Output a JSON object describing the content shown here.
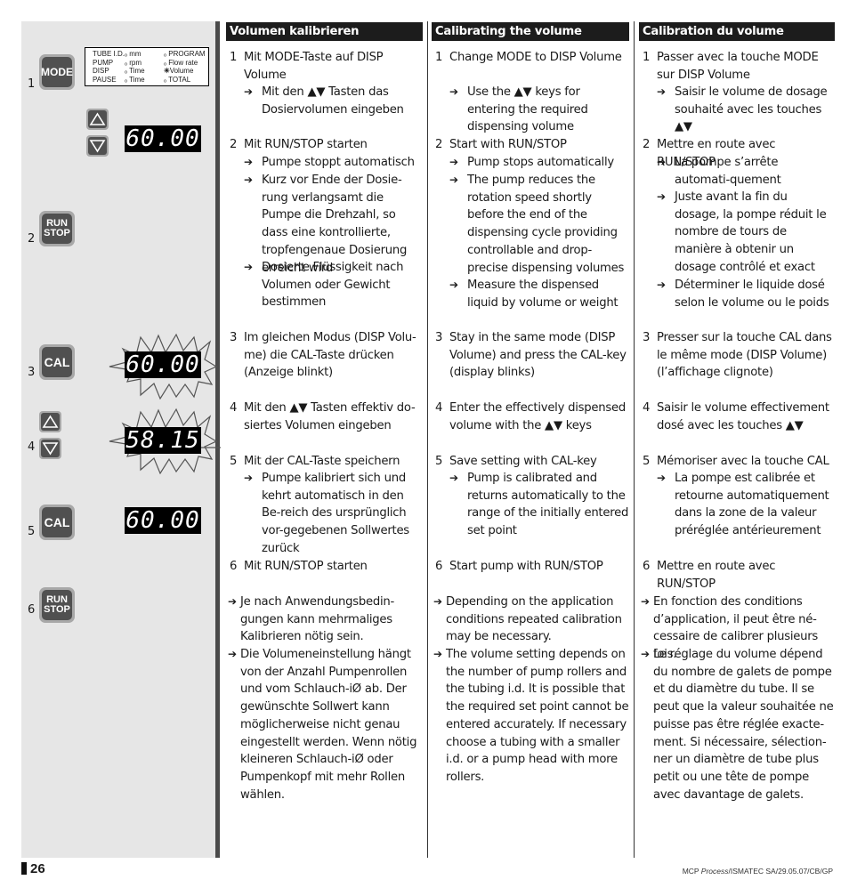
{
  "left_panel": {
    "step_numbers": [
      "1",
      "2",
      "3",
      "4",
      "5",
      "6"
    ],
    "keys": {
      "mode": "MODE",
      "run": "RUN",
      "stop": "STOP",
      "cal": "CAL"
    },
    "mode_display": {
      "col1": [
        "TUBE I.D.",
        "PUMP",
        "DISP",
        "PAUSE"
      ],
      "col2": [
        "mm",
        "rpm",
        "Time",
        "Time"
      ],
      "col3": [
        "PROGRAM",
        "Flow rate",
        "Volume",
        "TOTAL"
      ],
      "active_indicator": "Volume"
    },
    "displays": {
      "step1": "60.00",
      "step3": "60.00",
      "step4": "58.15",
      "step5": "60.00"
    }
  },
  "columns": [
    {
      "lang": "de",
      "title": "Volumen kalibrieren",
      "s1": "Mit MODE-Taste auf DISP Volume",
      "s1b1": "Mit den ▲▼ Tasten das Dosiervolumen eingeben",
      "s2": "Mit RUN/STOP starten",
      "s2b1": "Pumpe stoppt automatisch",
      "s2b2": "Kurz vor Ende der Dosie-rung verlangsamt die Pumpe die Drehzahl, so dass eine kontrollierte, tropfengenaue Dosierung erreicht wird",
      "s2b3": "Dosierte Flüssigkeit nach Volumen oder Gewicht bestimmen",
      "s3": "Im gleichen Modus (DISP Volu-me) die CAL-Taste drücken (Anzeige blinkt)",
      "s4": "Mit den ▲▼ Tasten effektiv do-siertes Volumen eingeben",
      "s5": "Mit der CAL-Taste speichern",
      "s5b1": "Pumpe kalibriert sich und kehrt automatisch in den Be-reich des ursprünglich vor-gegebenen Sollwertes zurück",
      "s6": "Mit RUN/STOP starten",
      "n1": "Je nach Anwendungsbedin-gungen kann mehrmaliges Kalibrieren nötig sein.",
      "n2": "Die Volumeneinstellung hängt von der Anzahl Pumpenrollen und vom Schlauch-iØ ab. Der gewünschte Sollwert kann möglicherweise nicht genau eingestellt werden. Wenn nötig kleineren Schlauch-iØ oder Pumpenkopf mit mehr Rollen wählen."
    },
    {
      "lang": "en",
      "title": "Calibrating the volume",
      "s1": "Change MODE to DISP Volume",
      "s1b1": "Use the ▲▼ keys for entering the required dispensing volume",
      "s2": "Start with RUN/STOP",
      "s2b1": "Pump stops automatically",
      "s2b2": "The pump reduces the rotation speed shortly before the end of the dispensing cycle providing controllable and drop-precise dispensing volumes",
      "s2b3": "Measure the dispensed liquid by volume or weight",
      "s3": "Stay in the same mode (DISP Volume) and press the CAL-key (display blinks)",
      "s4": "Enter the effectively dispensed volume with the ▲▼ keys",
      "s5": "Save setting with CAL-key",
      "s5b1": "Pump is calibrated and returns automatically to the range of the initially entered set point",
      "s6": "Start pump with RUN/STOP",
      "n1": "Depending on the application conditions repeated calibration may be necessary.",
      "n2": "The volume setting depends on the number of pump rollers and the tubing i.d. It is possible that the required set point cannot be entered accurately. If necessary choose a tubing with a smaller i.d. or a pump head with more rollers."
    },
    {
      "lang": "fr",
      "title": "Calibration du volume",
      "s1": "Passer avec la touche MODE sur DISP Volume",
      "s1b1": "Saisir le volume de dosage souhaité avec les touches ▲▼",
      "s2": "Mettre en route avec RUN/STOP",
      "s2b1": "La pompe s’arrête automati-quement",
      "s2b2": "Juste avant la fin du dosage, la pompe réduit le nombre de tours de manière à obtenir un dosage contrôlé et exact",
      "s2b3": "Déterminer le liquide dosé selon le volume ou le poids",
      "s3": "Presser sur la touche CAL dans le même mode (DISP Volume) (l’affichage clignote)",
      "s4": "Saisir le volume effectivement dosé avec les touches ▲▼",
      "s5": "Mémoriser avec la touche CAL",
      "s5b1": "La pompe est calibrée et retourne automatiquement dans la zone de la valeur préréglée antérieurement",
      "s6": "Mettre en route avec RUN/STOP",
      "n1": "En fonction des conditions d’application, il peut être né-cessaire de calibrer plusieurs fois.",
      "n2": "Le réglage du volume dépend du nombre de galets de pompe et du diamètre du tube. Il se peut que la valeur souhaitée ne puisse pas être réglée exacte-ment. Si nécessaire, sélection-ner un diamètre de tube plus petit ou une tête de pompe avec davantage de galets."
    }
  ],
  "footer": {
    "page_number": "26",
    "doc_ref_prefix": "MCP ",
    "doc_ref_italic": "Process",
    "doc_ref_suffix": "/ISMATEC SA/29.05.07/CB/GP"
  }
}
